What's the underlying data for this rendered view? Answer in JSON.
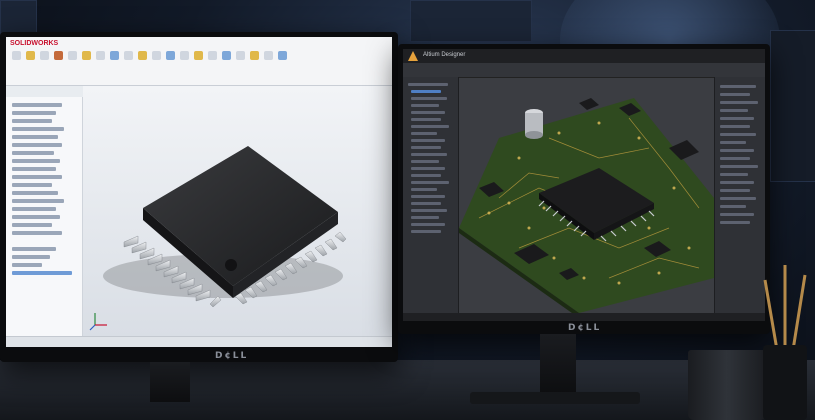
{
  "left_monitor": {
    "brand": "D¢LL",
    "app": {
      "logo_text": "SOLIDWORKS",
      "icon": "solidworks-logo-icon"
    }
  },
  "right_monitor": {
    "brand": "D¢LL",
    "app": {
      "title": "Altium Designer",
      "icon": "altium-logo-icon"
    }
  },
  "colors": {
    "solidworks_red": "#c8102e",
    "pcb_green": "#2f4a1f",
    "chip_black": "#1c1c1e",
    "pin_silver": "#c9ccd1",
    "room_blue": "#1b2536"
  }
}
